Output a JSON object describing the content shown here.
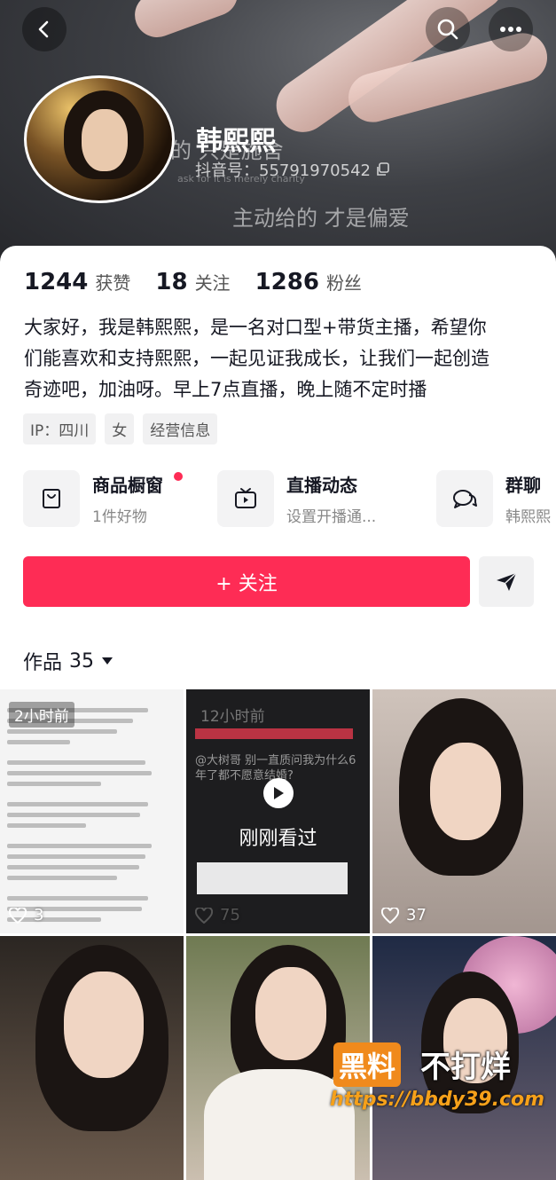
{
  "banner": {
    "overlay_line1": "的 只是施舍",
    "overlay_line2": "主动给的 才是偏爱",
    "overlay_small": "ask for it is merely charity"
  },
  "profile": {
    "name": "韩熙熙",
    "douyin_id": "抖音号：55791970542",
    "stats": [
      {
        "num": "1244",
        "label": "获赞"
      },
      {
        "num": "18",
        "label": "关注"
      },
      {
        "num": "1286",
        "label": "粉丝"
      }
    ],
    "bio_lines": [
      "大家好，我是韩熙熙，是一名对口型+带货主播，希望你",
      "们能喜欢和支持熙熙，一起见证我成长，让我们一起创造",
      "奇迹吧，加油呀。早上7点直播，晚上随不定时播"
    ],
    "tags": [
      "IP：四川",
      "女",
      "经营信息"
    ]
  },
  "entries": [
    {
      "title": "商品橱窗",
      "subtitle": "1件好物",
      "icon": "bag-icon"
    },
    {
      "title": "直播动态",
      "subtitle": "设置开播通...",
      "icon": "tv-icon"
    },
    {
      "title": "群聊",
      "subtitle": "韩熙熙",
      "icon": "chat-icon"
    }
  ],
  "actions": {
    "follow_label": "+ 关注"
  },
  "works": {
    "label": "作品",
    "count": "35",
    "items": [
      {
        "time": "2小时前",
        "likes": "3"
      },
      {
        "time": "12小时前",
        "likes": "75",
        "watched_label": "刚刚看过",
        "text_snippet": "@大树哥 别一直质问我为什么6年了都不愿意结婚?"
      },
      {
        "likes": "37"
      },
      {},
      {},
      {}
    ]
  },
  "watermark": {
    "brand_a": "黑料",
    "brand_b": "不打烊",
    "url": "https://bbdy39.com"
  },
  "colors": {
    "accent": "#fe2c55",
    "text": "#161823"
  }
}
